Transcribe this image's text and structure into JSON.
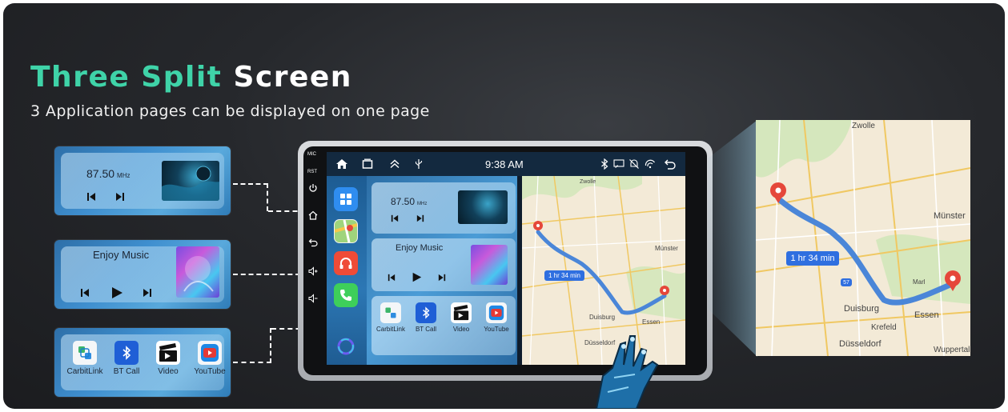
{
  "headline": {
    "accent": "Three Split",
    "rest": "Screen"
  },
  "subheadline": "3 Application pages can be displayed on one page",
  "radio": {
    "frequency": "87.50",
    "unit": "MHz"
  },
  "music": {
    "title": "Enjoy Music"
  },
  "apps": [
    {
      "label": "CarbitLink",
      "icon": "carbitlink-icon",
      "badge": "CarbitLink"
    },
    {
      "label": "BT Call",
      "icon": "bluetooth-icon"
    },
    {
      "label": "Video",
      "icon": "clapperboard-icon"
    },
    {
      "label": "YouTube",
      "icon": "youtube-icon"
    }
  ],
  "unit": {
    "time": "9:38 AM",
    "side_buttons": [
      "MIC",
      "RST"
    ],
    "status_icons": [
      "home-icon",
      "recent-apps-icon",
      "chevron-up-icon",
      "usb-icon",
      "bluetooth-icon",
      "screen-mirror-icon",
      "mute-icon",
      "wireless-icon",
      "back-icon"
    ],
    "dock_icons": [
      "app-grid-icon",
      "maps-icon",
      "music-icon",
      "phone-icon",
      "siri-icon"
    ]
  },
  "map": {
    "route_time": "1 hr 34 min",
    "places": [
      "Zwolle",
      "Münster",
      "Duisburg",
      "Essen",
      "Krefeld",
      "Düsseldorf",
      "Marl",
      "Wuppertal"
    ],
    "road_badge": "57"
  },
  "colors": {
    "accent": "#3fd3a8",
    "route": "#4a86d8",
    "pin": "#e5473a",
    "route_label_bg": "#2f6fe0"
  }
}
